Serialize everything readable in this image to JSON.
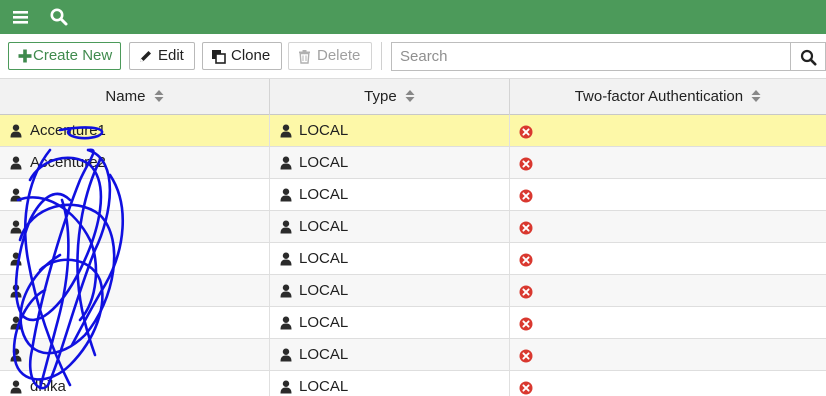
{
  "toolbar": {
    "create_label": "Create New",
    "edit_label": "Edit",
    "clone_label": "Clone",
    "delete_label": "Delete",
    "search_placeholder": "Search"
  },
  "table": {
    "columns": [
      "Name",
      "Type",
      "Two-factor Authentication"
    ],
    "rows": [
      {
        "name": "Accenture1",
        "type": "LOCAL",
        "two_factor": "disabled",
        "selected": true
      },
      {
        "name": "Accenture2",
        "type": "LOCAL",
        "two_factor": "disabled"
      },
      {
        "name": "",
        "type": "LOCAL",
        "two_factor": "disabled"
      },
      {
        "name": "",
        "type": "LOCAL",
        "two_factor": "disabled"
      },
      {
        "name": "",
        "type": "LOCAL",
        "two_factor": "disabled"
      },
      {
        "name": "",
        "type": "LOCAL",
        "two_factor": "disabled"
      },
      {
        "name": "",
        "type": "LOCAL",
        "two_factor": "disabled"
      },
      {
        "name": "",
        "type": "LOCAL",
        "two_factor": "disabled"
      },
      {
        "name": "dhika",
        "type": "LOCAL",
        "two_factor": "disabled"
      }
    ]
  },
  "colors": {
    "header_green": "#4c9a5a",
    "selected_row": "#fdf8a8",
    "status_red": "#d9382f",
    "redaction_blue": "#1010e0"
  },
  "icons": {
    "topbar": [
      "menu-icon",
      "search-icon"
    ],
    "row_user": "user-icon",
    "two_factor_status": "x-circle-icon"
  }
}
